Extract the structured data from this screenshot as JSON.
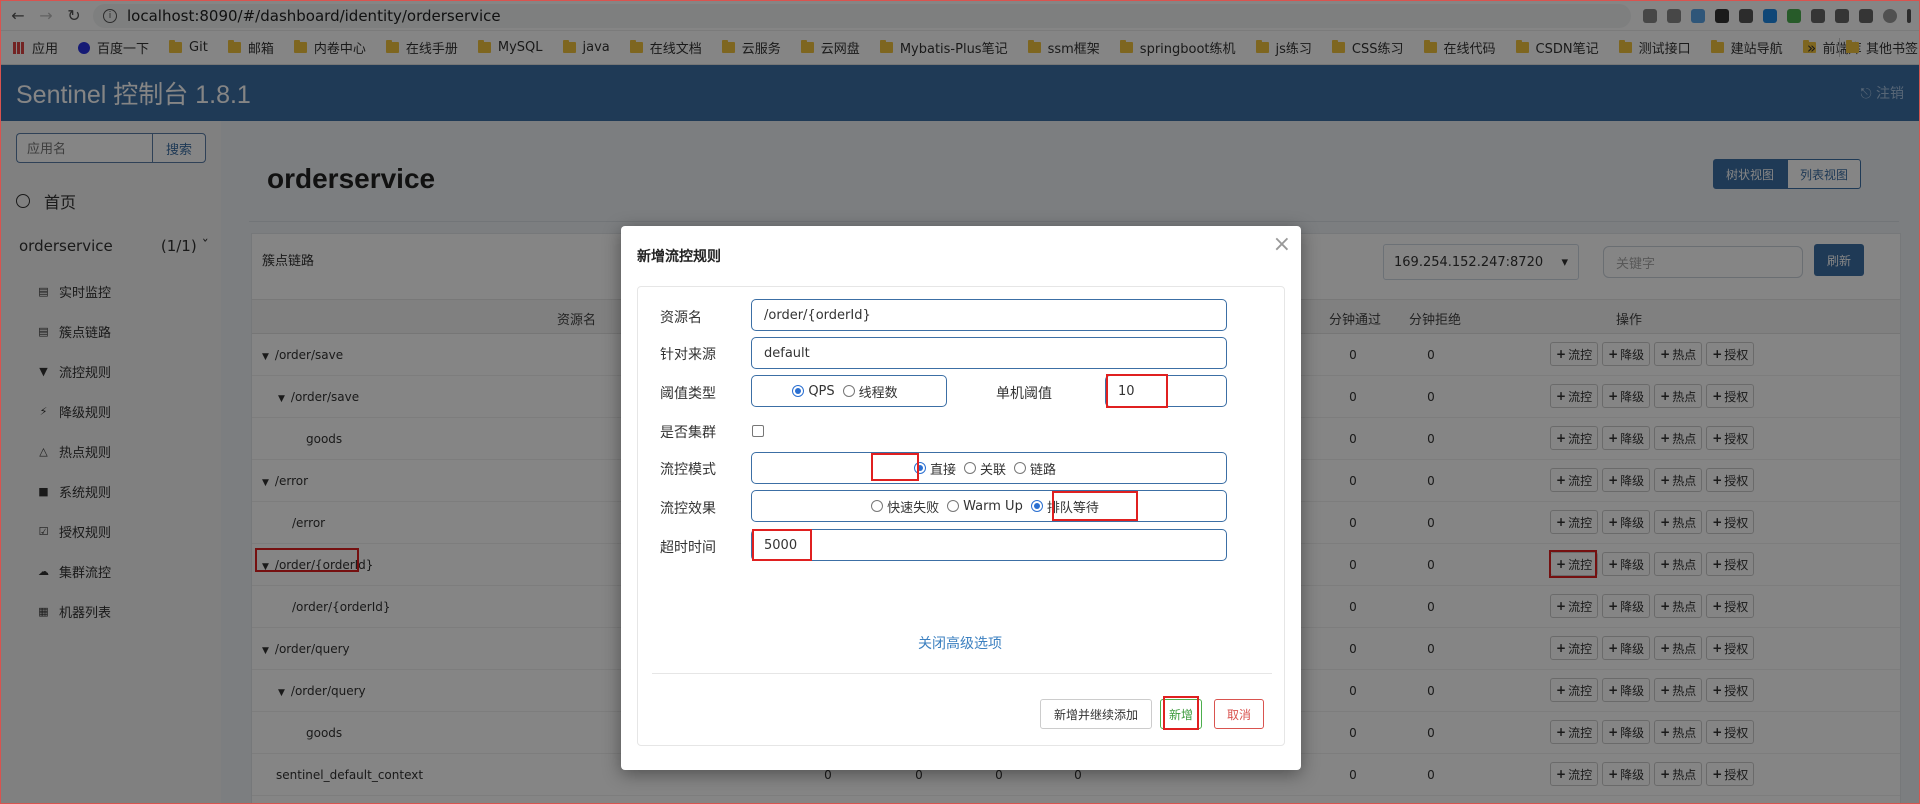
{
  "browser": {
    "url": "localhost:8090/#/dashboard/identity/orderservice"
  },
  "bookmarks": [
    "应用",
    "百度一下",
    "Git",
    "邮箱",
    "内卷中心",
    "在线手册",
    "MySQL",
    "java",
    "在线文档",
    "云服务",
    "云网盘",
    "Mybatis-Plus笔记",
    "ssm框架",
    "springboot练机",
    "js练习",
    "CSS练习",
    "在线代码",
    "CSDN笔记",
    "测试接口",
    "建站导航",
    "前端库"
  ],
  "bookmarks_more": "»",
  "bookmarks_other": "其他书签",
  "header": {
    "title": "Sentinel 控制台 1.8.1",
    "logout": "注销"
  },
  "sidebar": {
    "search_placeholder": "应用名",
    "search_button": "搜索",
    "home": "首页",
    "service": "orderservice",
    "service_count": "(1/1)",
    "items": [
      "实时监控",
      "簇点链路",
      "流控规则",
      "降级规则",
      "热点规则",
      "系统规则",
      "授权规则",
      "集群流控",
      "机器列表"
    ]
  },
  "main": {
    "title": "orderservice",
    "view_tree": "树状视图",
    "view_list": "列表视图",
    "panel_label": "簇点链路",
    "ip": "169.254.152.247:8720",
    "keyword_placeholder": "关键字",
    "refresh": "刷新",
    "columns": {
      "resource": "资源名",
      "pass_min": "分钟通过",
      "block_min": "分钟拒绝",
      "ops": "操作"
    },
    "rows": [
      {
        "name": "/order/save",
        "pass": "0",
        "block": "0",
        "extra": []
      },
      {
        "name": "/order/save",
        "pass": "0",
        "block": "0",
        "extra": []
      },
      {
        "name": "goods",
        "pass": "0",
        "block": "0",
        "extra": []
      },
      {
        "name": "/error",
        "pass": "0",
        "block": "0",
        "extra": []
      },
      {
        "name": "/error",
        "pass": "0",
        "block": "0",
        "extra": []
      },
      {
        "name": "/order/{orderId}",
        "pass": "0",
        "block": "0",
        "extra": []
      },
      {
        "name": "/order/{orderId}",
        "pass": "0",
        "block": "0",
        "extra": []
      },
      {
        "name": "/order/query",
        "pass": "0",
        "block": "0",
        "extra": []
      },
      {
        "name": "/order/query",
        "pass": "0",
        "block": "0",
        "extra": []
      },
      {
        "name": "goods",
        "pass": "0",
        "block": "0",
        "extra": []
      },
      {
        "name": "sentinel_default_context",
        "pass": "0",
        "block": "0",
        "extra": [
          "0",
          "0",
          "0",
          "0"
        ]
      }
    ],
    "ops": [
      "流控",
      "降级",
      "热点",
      "授权"
    ]
  },
  "modal": {
    "title": "新增流控规则",
    "labels": {
      "resource": "资源名",
      "origin": "针对来源",
      "grade": "阈值类型",
      "threshold": "单机阈值",
      "cluster": "是否集群",
      "mode": "流控模式",
      "effect": "流控效果",
      "timeout": "超时时间"
    },
    "resource": "/order/{orderId}",
    "origin": "default",
    "grade_options": [
      "QPS",
      "线程数"
    ],
    "threshold": "10",
    "mode_options": [
      "直接",
      "关联",
      "链路"
    ],
    "effect_options": [
      "快速失败",
      "Warm Up",
      "排队等待"
    ],
    "timeout": "5000",
    "advanced": "关闭高级选项",
    "btn_add_continue": "新增并继续添加",
    "btn_add": "新增",
    "btn_cancel": "取消"
  }
}
